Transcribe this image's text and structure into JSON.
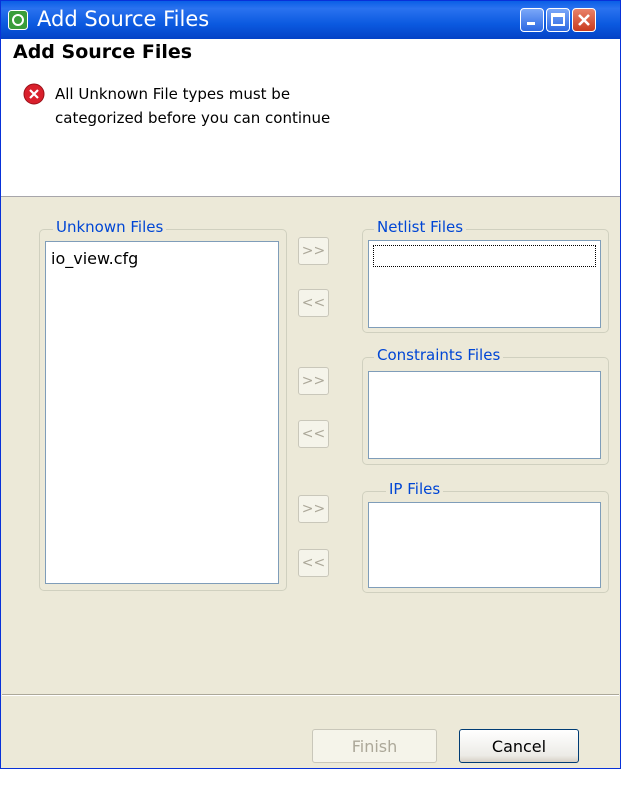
{
  "window": {
    "title": "Add Source Files"
  },
  "header": {
    "title": "Add Source Files",
    "error_line1": "All Unknown File types must be",
    "error_line2": "categorized before you can continue"
  },
  "groups": {
    "unknown": {
      "label": "Unknown Files",
      "items": [
        "io_view.cfg"
      ]
    },
    "netlist": {
      "label": "Netlist Files",
      "items": []
    },
    "constraints": {
      "label": "Constraints Files",
      "items": []
    },
    "ip": {
      "label": "IP Files",
      "items": []
    }
  },
  "move_buttons": {
    "add_label": ">>",
    "remove_label": "<<"
  },
  "buttons": {
    "finish_label": "Finish",
    "cancel_label": "Cancel"
  },
  "colors": {
    "title_bar": "#0a5fe6",
    "legend": "#0046d5",
    "error": "#d9202c",
    "dialog_bg": "#ece9d8"
  }
}
